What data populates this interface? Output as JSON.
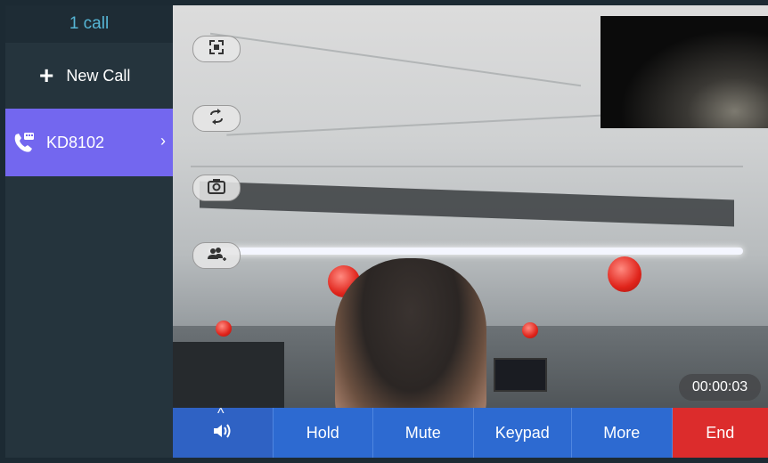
{
  "sidebar": {
    "call_count": "1 call",
    "new_call_label": "New Call",
    "active_call": {
      "name": "KD8102"
    }
  },
  "video": {
    "timer": "00:00:03",
    "controls": {
      "fullscreen": "fullscreen-icon",
      "swap": "swap-icon",
      "snapshot": "camera-icon",
      "add_participant": "add-participant-icon"
    }
  },
  "toolbar": {
    "volume_icon": "speaker-icon",
    "hold": "Hold",
    "mute": "Mute",
    "keypad": "Keypad",
    "more": "More",
    "end": "End"
  },
  "colors": {
    "accent_purple": "#7367ef",
    "toolbar_blue": "#2d6ad1",
    "end_red": "#dc2c2c",
    "header_cyan": "#56b6d6"
  }
}
